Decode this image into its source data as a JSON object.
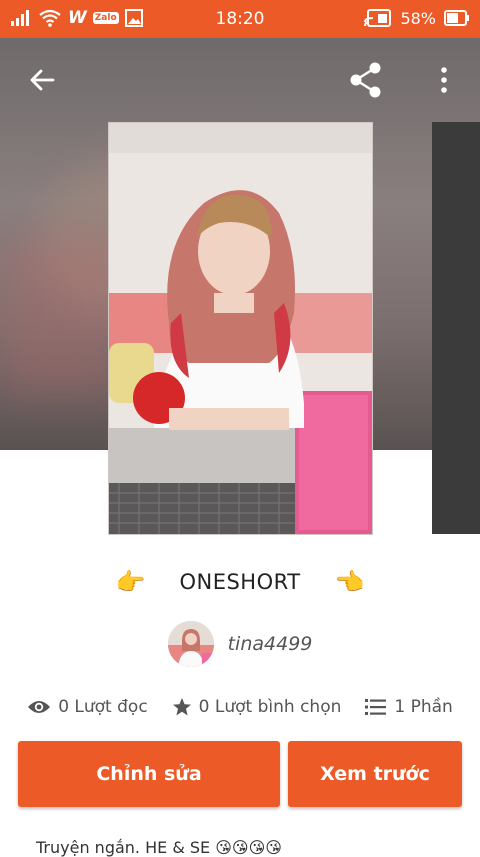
{
  "status_bar": {
    "time": "18:20",
    "battery": "58%",
    "zalo_label": "Zalo",
    "w_label": "W",
    "icons": [
      "signal-icon",
      "wifi-icon",
      "wattpad-notification-icon",
      "zalo-notification-icon",
      "image-notification-icon",
      "cast-icon",
      "battery-icon"
    ]
  },
  "toolbar": {
    "back_icon": "arrow-left-icon",
    "share_icon": "share-icon",
    "more_icon": "more-vertical-icon"
  },
  "story": {
    "title": "ONESHORT",
    "left_emoji": "👉",
    "right_emoji": "👈",
    "author": "tina4499",
    "stats": {
      "reads": "0 Lượt đọc",
      "votes": "0 Lượt bình chọn",
      "parts": "1 Phần"
    },
    "description": "Truyện ngắn. HE & SE 😘😘😘😘"
  },
  "actions": {
    "edit_label": "Chỉnh sửa",
    "preview_label": "Xem trước"
  },
  "colors": {
    "accent": "#ec5b27"
  }
}
